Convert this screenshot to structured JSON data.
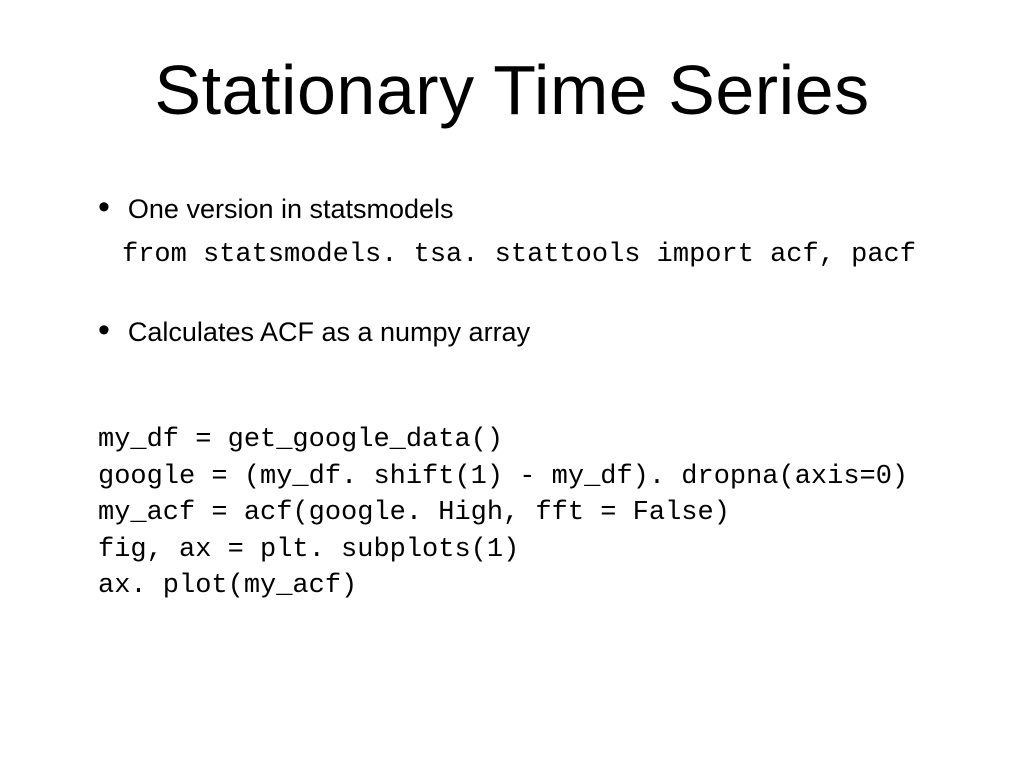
{
  "title": "Stationary Time Series",
  "bullets": {
    "b1": "One version in statsmodels",
    "b2": "Calculates ACF as a numpy array"
  },
  "code": {
    "import_line": "from statsmodels. tsa. stattools import acf, pacf",
    "snippet": "my_df = get_google_data()\ngoogle = (my_df. shift(1) - my_df). dropna(axis=0)\nmy_acf = acf(google. High, fft = False)\nfig, ax = plt. subplots(1)\nax. plot(my_acf)"
  }
}
